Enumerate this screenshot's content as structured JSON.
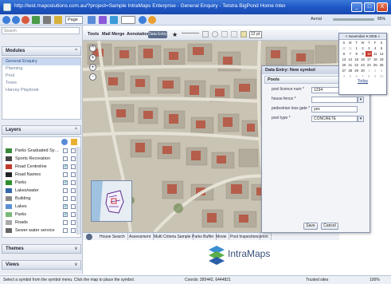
{
  "window": {
    "title": "http://test.maposlutions.com.au/?project=Sample  IntraMaps Enterprise - General Enquiry - Telstra BigPond Home Internet Explo",
    "controls": [
      "_",
      "□",
      "X"
    ]
  },
  "browser": {
    "page_label": "Page",
    "aerial_label": "Aerial",
    "zoom_label": "85%"
  },
  "left_panel": {
    "search_placeholder": "Search",
    "modules_title": "Modules",
    "modules": [
      {
        "label": "General Enquiry",
        "selected": true
      },
      {
        "label": "Planning",
        "selected": false
      },
      {
        "label": "Pool",
        "selected": false
      },
      {
        "label": "Trees",
        "selected": false
      },
      {
        "label": "Harvey Playbook",
        "selected": false
      }
    ],
    "layers_title": "Layers",
    "layers": [
      {
        "label": "Parks Graduated Symbol Theme",
        "icon_color": "#3a8a3a",
        "checked": false
      },
      {
        "label": "Sports Recreation",
        "icon_color": "#444",
        "checked": false
      },
      {
        "label": "Road Centreline",
        "icon_color": "#c0392b",
        "checked": true
      },
      {
        "label": "Road Names",
        "icon_color": "#222",
        "checked": false
      },
      {
        "label": "Parks",
        "icon_color": "#2f8f2f",
        "checked": true
      },
      {
        "label": "Lakes/water",
        "icon_color": "#3366aa",
        "checked": false
      },
      {
        "label": "Building",
        "icon_color": "#888",
        "checked": false
      },
      {
        "label": "Lakes",
        "icon_color": "#5b8fd6",
        "checked": true
      },
      {
        "label": "Parks",
        "icon_color": "#7ab87a",
        "checked": true
      },
      {
        "label": "Roads",
        "icon_color": "#aaa",
        "checked": false
      },
      {
        "label": "Sewer water service",
        "icon_color": "#666",
        "checked": false
      }
    ],
    "themes_title": "Themes",
    "views_title": "Views"
  },
  "map_toolbar": {
    "tabs": [
      "Tools",
      "Mail Merge",
      "Annotation"
    ],
    "draw_button": "Data Entry",
    "scale_value": "12 pt"
  },
  "bottom_tabs": [
    "House Search",
    "Assessment",
    "Multi Criteria Sample",
    "Parks Buffer",
    "Movie",
    "Pool Inspection",
    "comm"
  ],
  "popup": {
    "title": "Data Entry: New symbol",
    "section": "Pools",
    "fields": [
      {
        "label": "pool licence num *",
        "value": "1234",
        "type": "text"
      },
      {
        "label": "house fence *",
        "value": "",
        "type": "select"
      },
      {
        "label": "pedestrian loss gate *",
        "value": "yes",
        "type": "text"
      },
      {
        "label": "pool type *",
        "value": "CONCRETE",
        "type": "select"
      }
    ],
    "save_label": "Save",
    "cancel_label": "Cancel"
  },
  "calendar": {
    "month": "November",
    "year": "2005",
    "weekdays": [
      "S",
      "M",
      "T",
      "W",
      "T",
      "F",
      "S"
    ],
    "days": [
      [
        "30",
        "31",
        "1",
        "2",
        "3",
        "4",
        "5"
      ],
      [
        "6",
        "7",
        "8",
        "9",
        "10",
        "11",
        "12"
      ],
      [
        "13",
        "14",
        "15",
        "16",
        "17",
        "18",
        "19"
      ],
      [
        "20",
        "21",
        "22",
        "23",
        "24",
        "25",
        "26"
      ],
      [
        "27",
        "28",
        "29",
        "30",
        "1",
        "2",
        "3"
      ],
      [
        "4",
        "5",
        "6",
        "7",
        "8",
        "9",
        "10"
      ]
    ],
    "selected_day": "10",
    "today_label": "Today"
  },
  "logo_text": "IntraMaps",
  "status": {
    "message": "Select a symbol from the symbol menu. Click the map to place the symbol.",
    "coords": "Coords: 395442, 6444821",
    "zone": "Trusted sites",
    "zoom": "100%"
  }
}
